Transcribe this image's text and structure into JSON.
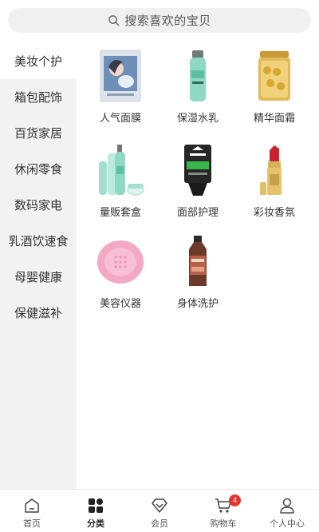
{
  "search": {
    "placeholder": "搜索喜欢的宝贝",
    "icon": "search-icon"
  },
  "sidebar": {
    "active_index": 0,
    "items": [
      {
        "label": "美妆个护"
      },
      {
        "label": "箱包配饰"
      },
      {
        "label": "百货家居"
      },
      {
        "label": "休闲零食"
      },
      {
        "label": "数码家电"
      },
      {
        "label": "乳酒饮速食"
      },
      {
        "label": "母婴健康"
      },
      {
        "label": "保健滋补"
      }
    ]
  },
  "products": [
    {
      "label": "人气面膜",
      "icon": "face-mask-image"
    },
    {
      "label": "保湿水乳",
      "icon": "moisturizer-bottle-image"
    },
    {
      "label": "精华面霜",
      "icon": "essence-capsules-image"
    },
    {
      "label": "量贩套盒",
      "icon": "gift-set-image"
    },
    {
      "label": "面部护理",
      "icon": "face-cleanser-image"
    },
    {
      "label": "彩妆香氛",
      "icon": "lipstick-image"
    },
    {
      "label": "美容仪器",
      "icon": "cleansing-device-image"
    },
    {
      "label": "身体洗护",
      "icon": "body-wash-image"
    }
  ],
  "tabbar": {
    "active_index": 1,
    "items": [
      {
        "label": "首页",
        "icon": "home-icon"
      },
      {
        "label": "分类",
        "icon": "category-grid-icon"
      },
      {
        "label": "会员",
        "icon": "diamond-icon"
      },
      {
        "label": "购物车",
        "icon": "cart-icon",
        "badge": "4"
      },
      {
        "label": "个人中心",
        "icon": "user-icon"
      }
    ]
  },
  "colors": {
    "accent_badge": "#e5332a",
    "sidebar_bg": "#f2f2f2",
    "search_bg": "#f0f0f0"
  }
}
